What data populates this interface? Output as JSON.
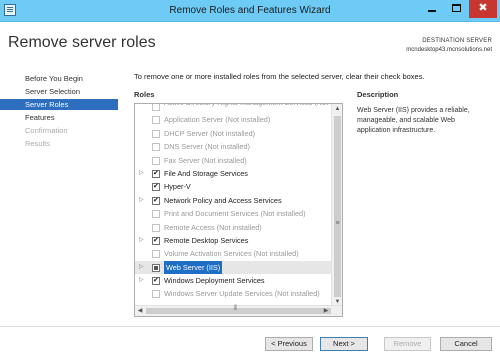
{
  "window": {
    "title": "Remove Roles and Features Wizard",
    "minimize_icon": "minimize-icon",
    "maximize_icon": "maximize-icon",
    "close_glyph": "✖"
  },
  "header": {
    "page_title": "Remove server roles",
    "destination_label": "DESTINATION SERVER",
    "destination_server": "mcndesktop43.mcnsolutions.net"
  },
  "nav": {
    "items": [
      {
        "label": "Before You Begin",
        "state": "normal"
      },
      {
        "label": "Server Selection",
        "state": "normal"
      },
      {
        "label": "Server Roles",
        "state": "active"
      },
      {
        "label": "Features",
        "state": "normal"
      },
      {
        "label": "Confirmation",
        "state": "disabled"
      },
      {
        "label": "Results",
        "state": "disabled"
      }
    ]
  },
  "main": {
    "instruction": "To remove one or more installed roles from the selected server, clear their check boxes.",
    "roles_heading": "Roles",
    "description_heading": "Description",
    "description_text": "Web Server (IIS) provides a reliable, manageable, and scalable Web application infrastructure.",
    "roles": [
      {
        "label": "Active Directory Rights Management Services (Not installed)",
        "checked": false,
        "installed": false,
        "expandable": false
      },
      {
        "label": "Application Server (Not installed)",
        "checked": false,
        "installed": false,
        "expandable": false
      },
      {
        "label": "DHCP Server (Not installed)",
        "checked": false,
        "installed": false,
        "expandable": false
      },
      {
        "label": "DNS Server (Not installed)",
        "checked": false,
        "installed": false,
        "expandable": false
      },
      {
        "label": "Fax Server (Not installed)",
        "checked": false,
        "installed": false,
        "expandable": false
      },
      {
        "label": "File And Storage Services",
        "checked": true,
        "installed": true,
        "expandable": true
      },
      {
        "label": "Hyper-V",
        "checked": true,
        "installed": true,
        "expandable": false
      },
      {
        "label": "Network Policy and Access Services",
        "checked": true,
        "installed": true,
        "expandable": true
      },
      {
        "label": "Print and Document Services (Not installed)",
        "checked": false,
        "installed": false,
        "expandable": false
      },
      {
        "label": "Remote Access (Not installed)",
        "checked": false,
        "installed": false,
        "expandable": false
      },
      {
        "label": "Remote Desktop Services",
        "checked": true,
        "installed": true,
        "expandable": true
      },
      {
        "label": "Volume Activation Services (Not installed)",
        "checked": false,
        "installed": false,
        "expandable": false
      },
      {
        "label": "Web Server (IIS)",
        "checked": "partial",
        "installed": true,
        "expandable": true,
        "selected": true
      },
      {
        "label": "Windows Deployment Services",
        "checked": true,
        "installed": true,
        "expandable": true
      },
      {
        "label": "Windows Server Update Services (Not installed)",
        "checked": false,
        "installed": false,
        "expandable": false
      }
    ]
  },
  "footer": {
    "previous": "< Previous",
    "next": "Next >",
    "remove": "Remove",
    "cancel": "Cancel"
  },
  "colors": {
    "titlebar": "#6ecbf5",
    "accent": "#2d6ebf",
    "selection": "#1f6ec5",
    "close": "#c7372f"
  }
}
